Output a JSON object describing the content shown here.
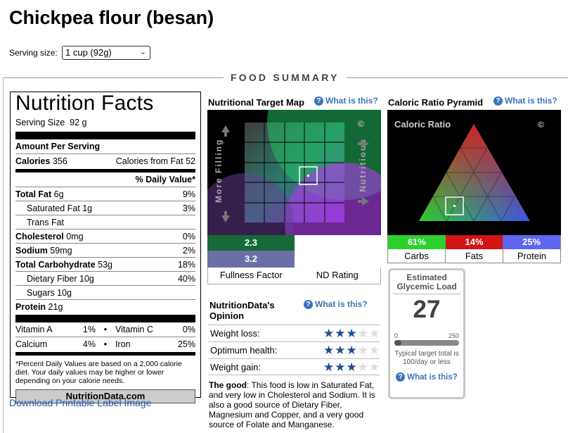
{
  "page": {
    "title": "Chickpea flour (besan)"
  },
  "serving": {
    "label": "Serving size:",
    "selected": "1 cup (92g)"
  },
  "summary_title": "FOOD SUMMARY",
  "nutrition_facts": {
    "title": "Nutrition Facts",
    "serving_size_label": "Serving Size",
    "serving_size_value": "92 g",
    "amount_per_serving": "Amount Per Serving",
    "calories_label": "Calories",
    "calories_value": "356",
    "calories_from_fat_label": "Calories from Fat",
    "calories_from_fat_value": "52",
    "daily_value_header": "% Daily Value*",
    "rows": [
      {
        "name": "Total Fat",
        "amount": "6g",
        "dv": "9%"
      },
      {
        "name": "Saturated Fat",
        "amount": "1g",
        "dv": "3%"
      },
      {
        "name": "Trans Fat",
        "amount": "",
        "dv": ""
      },
      {
        "name": "Cholesterol",
        "amount": "0mg",
        "dv": "0%"
      },
      {
        "name": "Sodium",
        "amount": "59mg",
        "dv": "2%"
      },
      {
        "name": "Total Carbohydrate",
        "amount": "53g",
        "dv": "18%"
      },
      {
        "name": "Dietary Fiber",
        "amount": "10g",
        "dv": "40%"
      },
      {
        "name": "Sugars",
        "amount": "10g",
        "dv": ""
      },
      {
        "name": "Protein",
        "amount": "21g",
        "dv": ""
      }
    ],
    "vitamins": [
      {
        "name": "Vitamin A",
        "dv": "1%",
        "name2": "Vitamin C",
        "dv2": "0%"
      },
      {
        "name": "Calcium",
        "dv": "4%",
        "name2": "Iron",
        "dv2": "25%"
      }
    ],
    "footnote": "*Percent Daily Values are based on a 2,000 calorie diet. Your daily values may be higher or lower depending on your calorie needs.",
    "brand": "NutritionData.com"
  },
  "download_link": "Download Printable Label Image",
  "target_map": {
    "heading": "Nutritional Target Map",
    "what_is": "What is this?",
    "left_label": "More Filling",
    "right_label": "Nutritious",
    "copyright": "©",
    "fullness_value": "2.3",
    "nd_value": "3.2",
    "fullness_label": "Fullness Factor",
    "nd_label": "ND Rating"
  },
  "pyramid": {
    "heading": "Caloric Ratio Pyramid",
    "what_is": "What is this?",
    "inner_title": "Caloric Ratio",
    "copyright": "©",
    "carbs_pct": "61%",
    "fats_pct": "14%",
    "protein_pct": "25%",
    "carbs_label": "Carbs",
    "fats_label": "Fats",
    "protein_label": "Protein",
    "colors": {
      "carbs": "#2cd12c",
      "fats": "#d11414",
      "protein": "#5f66f0"
    }
  },
  "glycemic": {
    "title": "Estimated Glycemic Load",
    "value": "27",
    "scale_min": "0",
    "scale_max": "250",
    "fill_fraction": 0.11,
    "note": "Typical target total is 100/day or less",
    "what_is": "What is this?"
  },
  "opinion": {
    "heading": "NutritionData's Opinion",
    "what_is": "What is this?",
    "rows": [
      {
        "label": "Weight loss:",
        "stars": 2.5
      },
      {
        "label": "Optimum health:",
        "stars": 2.5
      },
      {
        "label": "Weight gain:",
        "stars": 3
      }
    ],
    "good_label": "The good",
    "good_text": ": This food is low in Saturated Fat, and very low in Cholesterol and Sodium. It is also a good source of Dietary Fiber, Magnesium and Copper, and a very good source of Folate and Manganese."
  }
}
